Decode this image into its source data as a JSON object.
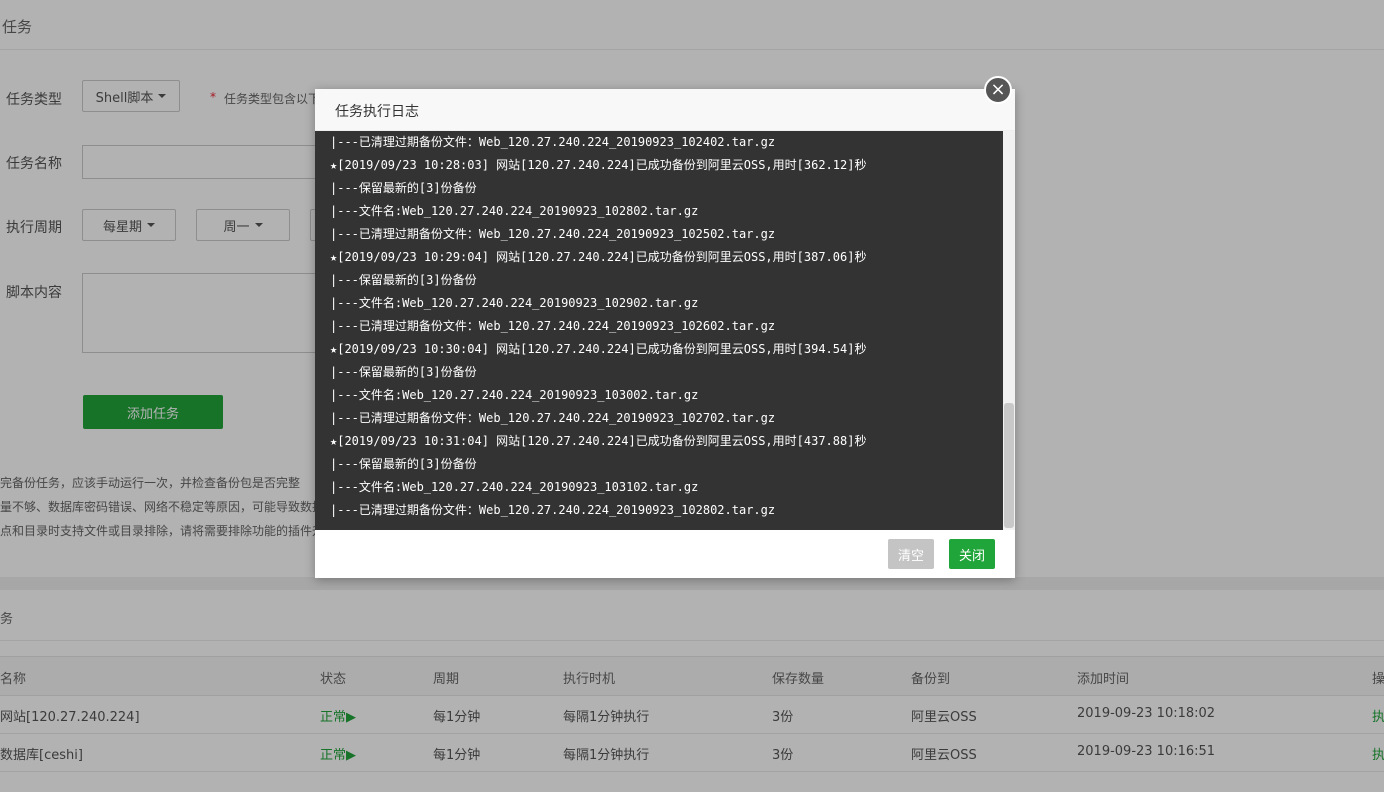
{
  "page": {
    "title": "任务"
  },
  "form": {
    "task_type_label": "任务类型",
    "task_type_value": "Shell脚本",
    "task_type_hint_star": "*",
    "task_type_hint": "任务类型包含以下",
    "task_name_label": "任务名称",
    "task_name_value": "",
    "period_label": "执行周期",
    "period_type": "每星期",
    "period_day": "周一",
    "script_label": "脚本内容",
    "script_value": "",
    "add_button": "添加任务"
  },
  "notes": [
    "完备份任务，应该手动运行一次，并检查备份包是否完整",
    "量不够、数据库密码错误、网络不稳定等原因，可能导致数据",
    "点和目录时支持文件或目录排除，请将需要排除功能的插件升"
  ],
  "task_list": {
    "header": "务",
    "columns": [
      "名称",
      "状态",
      "周期",
      "执行时机",
      "保存数量",
      "备份到",
      "添加时间",
      "操"
    ],
    "rows": [
      {
        "name": "网站[120.27.240.224]",
        "status": "正常▶",
        "period": "每1分钟",
        "timing": "每隔1分钟执行",
        "keep": "3份",
        "target": "阿里云OSS",
        "added": "2019-09-23 10:18:02",
        "op": "执"
      },
      {
        "name": "数据库[ceshi]",
        "status": "正常▶",
        "period": "每1分钟",
        "timing": "每隔1分钟执行",
        "keep": "3份",
        "target": "阿里云OSS",
        "added": "2019-09-23 10:16:51",
        "op": "执"
      }
    ]
  },
  "dialog": {
    "title": "任务执行日志",
    "close_icon": "×",
    "log_lines": [
      "|---已清理过期备份文件：Web_120.27.240.224_20190923_102402.tar.gz",
      "★[2019/09/23 10:28:03] 网站[120.27.240.224]已成功备份到阿里云OSS,用时[362.12]秒",
      "|---保留最新的[3]份备份",
      "|---文件名:Web_120.27.240.224_20190923_102802.tar.gz",
      "|---已清理过期备份文件：Web_120.27.240.224_20190923_102502.tar.gz",
      "★[2019/09/23 10:29:04] 网站[120.27.240.224]已成功备份到阿里云OSS,用时[387.06]秒",
      "|---保留最新的[3]份备份",
      "|---文件名:Web_120.27.240.224_20190923_102902.tar.gz",
      "|---已清理过期备份文件：Web_120.27.240.224_20190923_102602.tar.gz",
      "★[2019/09/23 10:30:04] 网站[120.27.240.224]已成功备份到阿里云OSS,用时[394.54]秒",
      "|---保留最新的[3]份备份",
      "|---文件名:Web_120.27.240.224_20190923_103002.tar.gz",
      "|---已清理过期备份文件：Web_120.27.240.224_20190923_102702.tar.gz",
      "★[2019/09/23 10:31:04] 网站[120.27.240.224]已成功备份到阿里云OSS,用时[437.88]秒",
      "|---保留最新的[3]份备份",
      "|---文件名:Web_120.27.240.224_20190923_103102.tar.gz",
      "|---已清理过期备份文件：Web_120.27.240.224_20190923_102802.tar.gz"
    ],
    "clear_button": "清空",
    "close_button": "关闭"
  },
  "colors": {
    "accent": "#20a53a",
    "log_bg": "#333333"
  }
}
